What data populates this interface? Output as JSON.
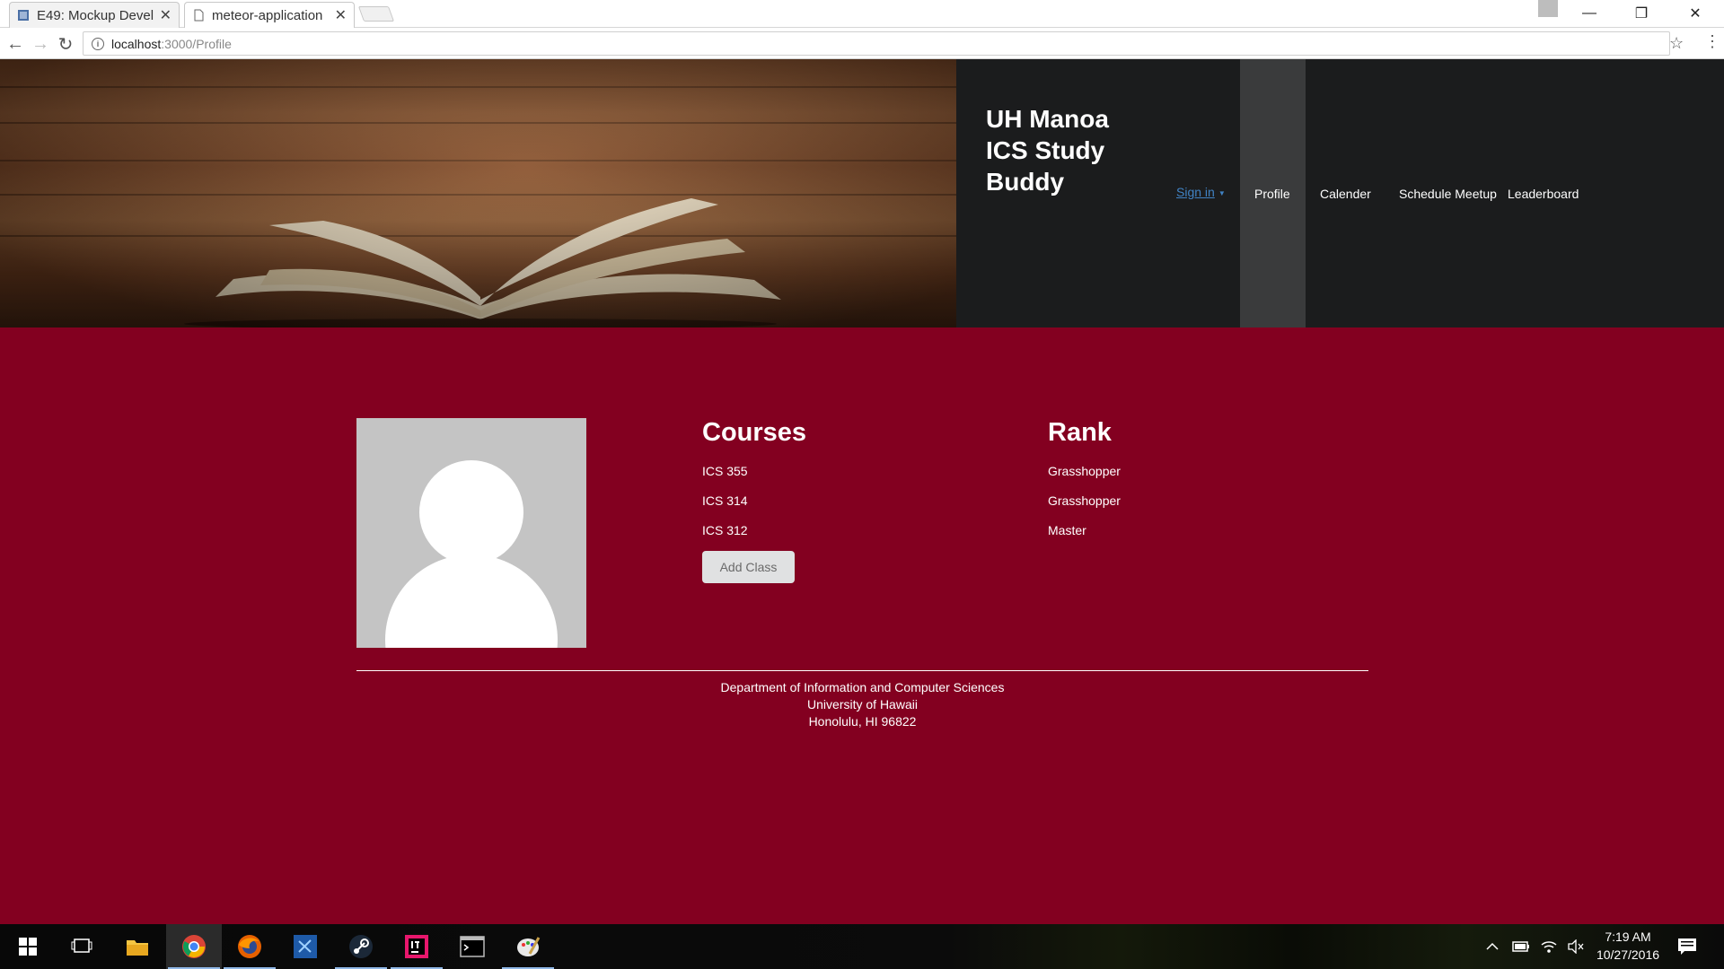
{
  "browser": {
    "tabs": [
      {
        "title": "E49: Mockup Devel",
        "active": false
      },
      {
        "title": "meteor-application",
        "active": true
      }
    ],
    "url_host": "localhost",
    "url_path": ":3000/Profile"
  },
  "header": {
    "brand": "UH Manoa ICS Study Buddy",
    "sign_in": "Sign in",
    "nav": [
      {
        "label": "Profile",
        "active": true
      },
      {
        "label": "Calender",
        "active": false
      },
      {
        "label": "Schedule Meetup",
        "active": false
      },
      {
        "label": "Leaderboard",
        "active": false
      }
    ]
  },
  "main": {
    "courses_title": "Courses",
    "courses": [
      "ICS 355",
      "ICS 314",
      "ICS 312"
    ],
    "add_class_label": "Add Class",
    "rank_title": "Rank",
    "ranks": [
      "Grasshopper",
      "Grasshopper",
      "Master"
    ]
  },
  "footer": {
    "line1": "Department of Information and Computer Sciences",
    "line2": "University of Hawaii",
    "line3": "Honolulu, HI 96822"
  },
  "taskbar": {
    "time": "7:19 AM",
    "date": "10/27/2016",
    "apps": [
      "windows-start-icon",
      "task-view-icon",
      "file-explorer-icon",
      "chrome-icon",
      "firefox-icon",
      "visual-studio-icon",
      "steam-icon",
      "intellij-icon",
      "terminal-icon",
      "paint-icon"
    ]
  },
  "colors": {
    "page_background": "#830020",
    "navbar_background": "#1b1c1d",
    "nav_active": "#3a3b3c",
    "link": "#4183c4"
  }
}
